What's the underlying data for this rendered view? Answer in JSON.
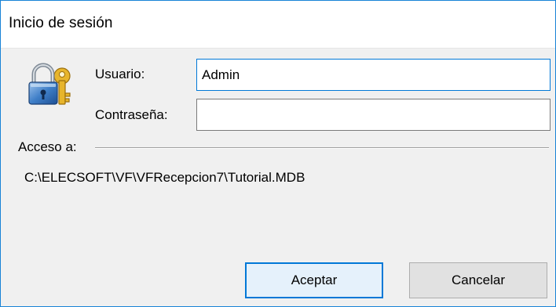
{
  "window": {
    "title": "Inicio de sesión"
  },
  "form": {
    "user_label": "Usuario:",
    "user_value": "Admin",
    "password_label": "Contraseña:",
    "password_value": ""
  },
  "access": {
    "group_label": "Acceso a:",
    "path": "C:\\ELECSOFT\\VF\\VFRecepcion7\\Tutorial.MDB"
  },
  "buttons": {
    "accept_label": "Aceptar",
    "cancel_label": "Cancelar"
  },
  "icons": {
    "lock": "lock-key-icon"
  },
  "colors": {
    "accent": "#0078d7",
    "window_border": "#1883d7",
    "dialog_bg": "#f0f0f0"
  }
}
